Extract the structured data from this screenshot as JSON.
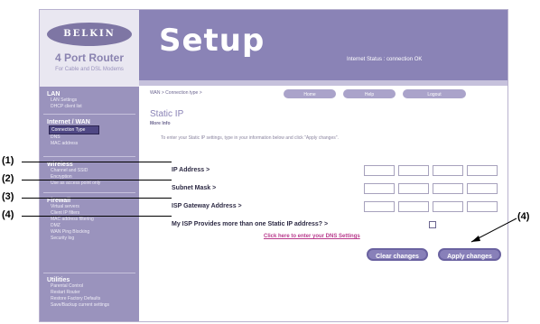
{
  "sidebar": {
    "logo": "BELKIN",
    "router_name": "4 Port Router",
    "router_subtitle": "For Cable and DSL Modems",
    "sections": [
      {
        "title": "LAN",
        "items": [
          "LAN Settings",
          "DHCP client list"
        ]
      },
      {
        "title": "Internet / WAN",
        "items": [
          "Connection Type",
          "DNS",
          "MAC address"
        ],
        "current": "Connection Type"
      },
      {
        "title": "Wireless",
        "items": [
          "Channel and SSID",
          "Encryption",
          "Use as access point only"
        ]
      },
      {
        "title": "Firewall",
        "items": [
          "Virtual servers",
          "Client IP filters",
          "MAC address filtering",
          "DMZ",
          "WAN Ping Blocking",
          "Security log"
        ]
      },
      {
        "title": "Utilities",
        "items": [
          "Parental Control",
          "Restart Router",
          "Restore Factory Defaults",
          "Save/Backup current settings"
        ]
      }
    ]
  },
  "header": {
    "title": "Setup",
    "internet_status": "Internet Status : connection OK"
  },
  "main": {
    "breadcrumb": "WAN > Connection type >",
    "nav_buttons": [
      "Home",
      "Help",
      "Logout"
    ],
    "heading": "Static IP",
    "more_info": "More Info",
    "intro": "To enter your Static IP settings, type in your information below and click \"Apply changes\".",
    "fields": [
      {
        "label": "IP Address >"
      },
      {
        "label": "Subnet Mask >"
      },
      {
        "label": "ISP Gateway Address >"
      }
    ],
    "isp_question": "My ISP Provides more than one Static IP address? >",
    "isp_checked": false,
    "dns_link": "Click here to enter your DNS Settings",
    "clear_label": "Clear changes",
    "apply_label": "Apply changes"
  },
  "callouts": {
    "ip": "(1)",
    "subnet": "(2)",
    "gateway": "(3)",
    "isp": "(4)",
    "apply": "(4)"
  },
  "colors": {
    "accent": "#8a83b6",
    "sidebar": "#9a93bd",
    "link": "#b83a8c"
  }
}
